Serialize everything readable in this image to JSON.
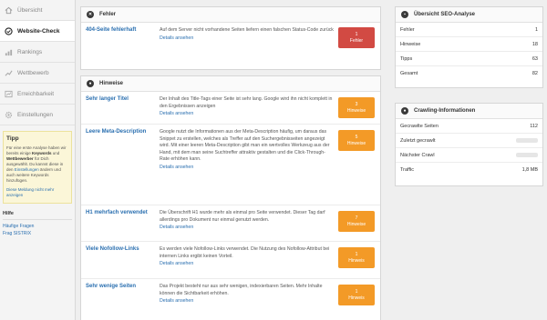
{
  "sidebar": {
    "items": [
      {
        "label": "Übersicht",
        "icon": "home-icon"
      },
      {
        "label": "Website-Check",
        "icon": "website-check-icon"
      },
      {
        "label": "Rankings",
        "icon": "bar-chart-icon"
      },
      {
        "label": "Wettbewerb",
        "icon": "trend-icon"
      },
      {
        "label": "Erreichbarkeit",
        "icon": "signal-icon"
      },
      {
        "label": "Einstellungen",
        "icon": "gear-icon"
      }
    ],
    "tip": {
      "title": "Tipp",
      "part1": "Für eine erste Analyse haben wir bereits einige ",
      "keywords": "Keywords",
      "part2": " und ",
      "competitors": "Wettbewerber",
      "part3": " für Dich ausgewählt. Du kannst diese in den ",
      "settings_link": "Einstellungen",
      "part4": " ändern und auch weitere Keywords hinzufügen.",
      "dismiss": "Diese Meldung nicht mehr anzeigen"
    },
    "help": {
      "title": "Hilfe",
      "links": [
        "Häufige Fragen",
        "Frag SISTRIX"
      ]
    }
  },
  "errors_panel": {
    "title": "Fehler",
    "rows": [
      {
        "title": "404-Seite fehlerhaft",
        "text": "Auf dem Server nicht vorhandene Seiten liefern einen falschen Status-Code zurück",
        "link": "Details ansehen",
        "badge_count": "1",
        "badge_label": "Fehler"
      }
    ]
  },
  "hints_panel": {
    "title": "Hinweise",
    "rows": [
      {
        "title": "Sehr langer Titel",
        "text": "Der Inhalt des Title-Tags einer Seite ist sehr lang. Google wird ihn nicht komplett in den Ergebnissen anzeigen",
        "link": "Details ansehen",
        "badge_count": "3",
        "badge_label": "Hinweise"
      },
      {
        "title": "Leere Meta-Description",
        "text": "Google nutzt die Informationen aus der Meta-Description häufig, um daraus das Snippet zu erstellen, welches als Treffer auf den Suchergebnisseiten angezeigt wird. Mit einer leeren Meta-Description gibt man ein wertvolles Werkzeug aus der Hand, mit dem man seine Suchtreffer attraktiv gestalten und die Click-Through-Rate erhöhen kann.",
        "link": "Details ansehen",
        "badge_count": "5",
        "badge_label": "Hinweise"
      },
      {
        "title": "H1 mehrfach verwendet",
        "text": "Die Überschrift H1 wurde mehr als einmal pro Seite verwendet. Dieser Tag darf allerdings pro Dokument nur einmal genutzt werden.",
        "link": "Details ansehen",
        "badge_count": "7",
        "badge_label": "Hinweise"
      },
      {
        "title": "Viele Nofollow-Links",
        "text": "Es werden viele Nofollow-Links verwendet. Die Nutzung des Nofollow-Attribut bei internen Links ergibt keinen Vorteil.",
        "link": "Details ansehen",
        "badge_count": "1",
        "badge_label": "Hinweis"
      },
      {
        "title": "Sehr wenige Seiten",
        "text": "Das Projekt besteht nur aus sehr wenigen, indexierbaren Seiten. Mehr Inhalte können die Sichtbarkeit erhöhen.",
        "link": "Details ansehen",
        "badge_count": "1",
        "badge_label": "Hinweis"
      }
    ]
  },
  "seo_overview": {
    "title": "Übersicht SEO-Analyse",
    "rows": [
      {
        "label": "Fehler",
        "value": "1"
      },
      {
        "label": "Hinweise",
        "value": "18"
      },
      {
        "label": "Tipps",
        "value": "63"
      },
      {
        "label": "Gesamt",
        "value": "82"
      }
    ]
  },
  "crawling": {
    "title": "Crawling-Informationen",
    "rows": [
      {
        "label": "Gecrawlte Seiten",
        "value": "112"
      },
      {
        "label": "Zuletzt gecrawlt",
        "value": ""
      },
      {
        "label": "Nächster Crawl",
        "value": ""
      },
      {
        "label": "Traffic",
        "value": "1,8 MB"
      }
    ]
  },
  "colors": {
    "error_badge": "#d24a43",
    "hint_badge": "#f39a27",
    "link": "#2a6fb0"
  }
}
